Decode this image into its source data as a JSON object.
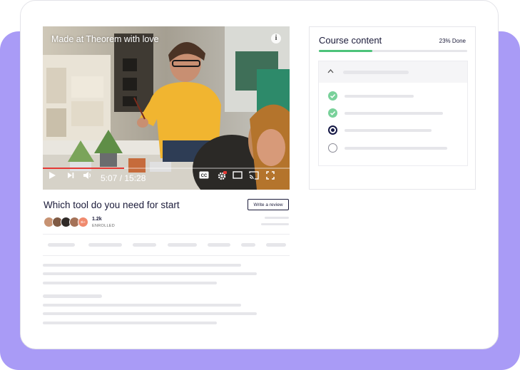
{
  "video": {
    "title": "Made at Theorem with love",
    "time": "5:07 / 15:28",
    "progress_fraction": 0.33
  },
  "course": {
    "title": "Which tool do you need for start",
    "review_button": "Write a review",
    "enrolled_count": "1.2k",
    "enrolled_label": "ENROLLED",
    "avatar_more": "3k+"
  },
  "sidebar": {
    "title": "Course content",
    "progress_label": "23% Done",
    "progress_fraction": 0.36,
    "lessons": [
      {
        "status": "done"
      },
      {
        "status": "done"
      },
      {
        "status": "current"
      },
      {
        "status": "todo"
      }
    ]
  },
  "colors": {
    "accent_purple": "#a99bf6",
    "progress_green": "#4cc37a",
    "video_red": "#e53935",
    "navy": "#1b1b3a"
  },
  "icons": [
    "info-icon",
    "play-icon",
    "skip-next-icon",
    "volume-icon",
    "captions-icon",
    "settings-icon",
    "miniplayer-icon",
    "cast-icon",
    "fullscreen-icon",
    "chevron-up-icon",
    "check-icon"
  ]
}
